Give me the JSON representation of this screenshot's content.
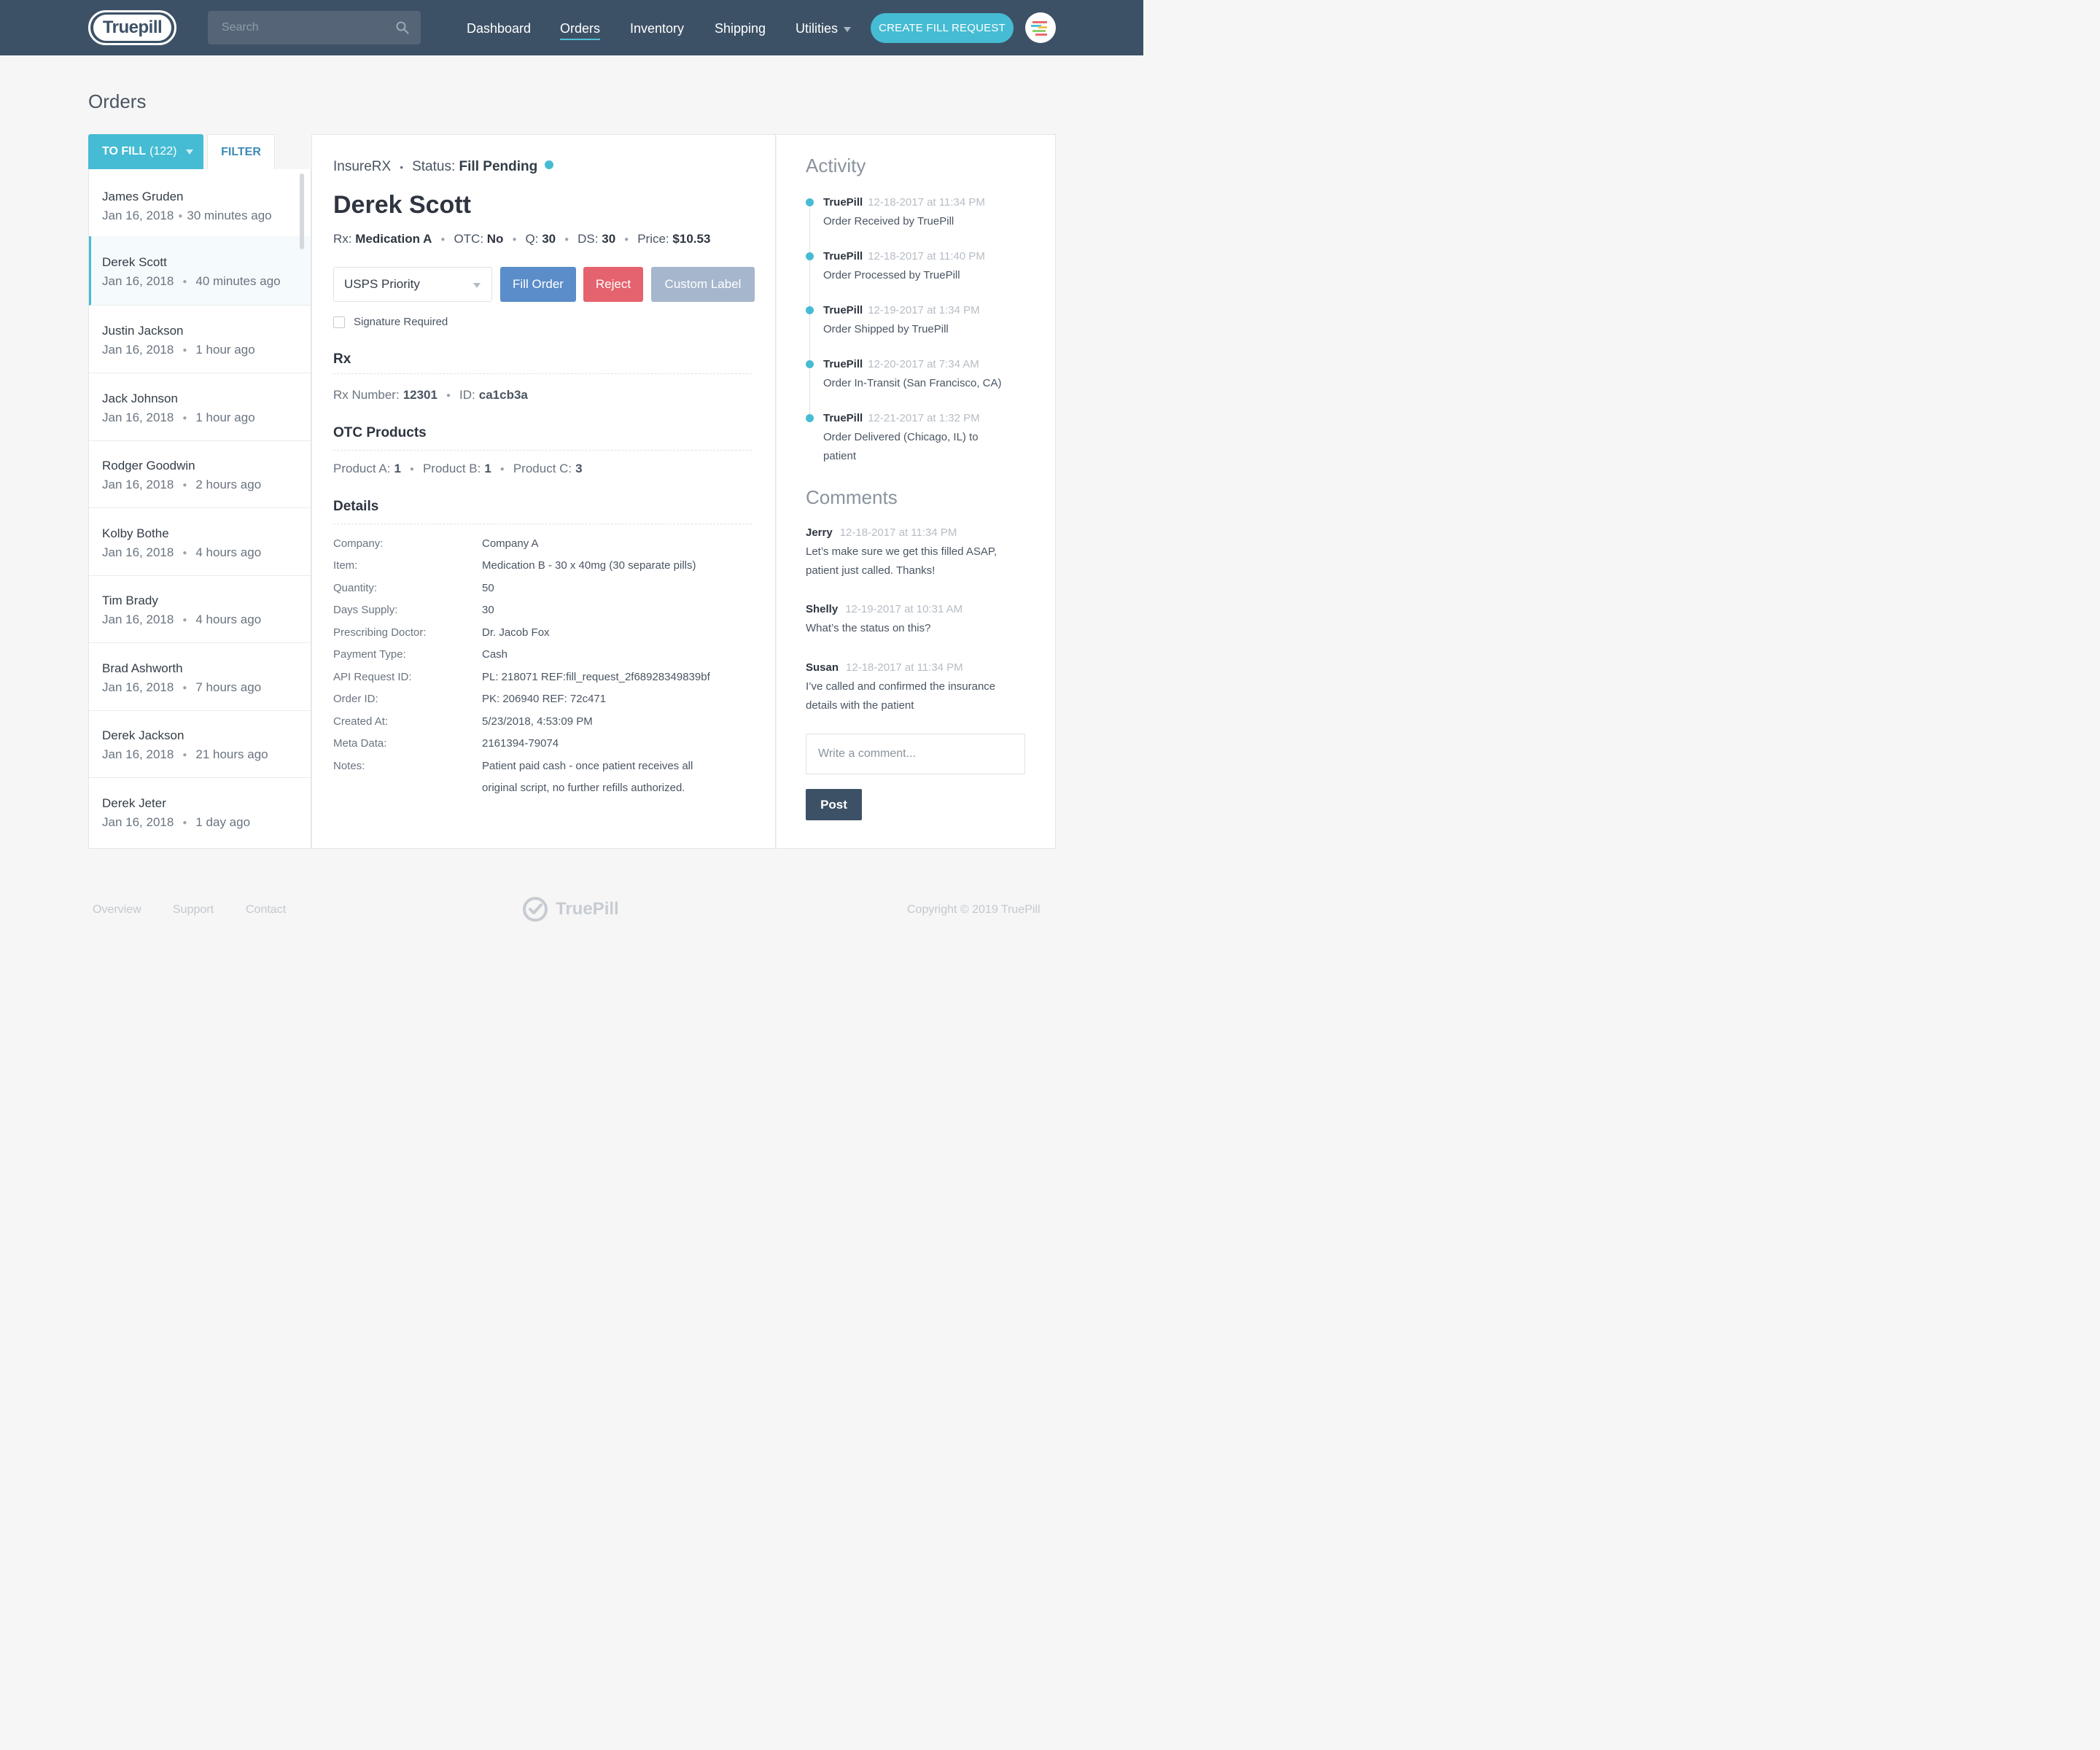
{
  "nav": {
    "logo_text": "Truepill",
    "search_placeholder": "Search",
    "links": [
      "Dashboard",
      "Orders",
      "Inventory",
      "Shipping",
      "Utilities"
    ],
    "create_button": "CREATE FILL REQUEST"
  },
  "page_title": "Orders",
  "tabs": {
    "to_fill": "TO FILL",
    "to_fill_count": "(122)",
    "filter": "FILTER"
  },
  "orders": [
    {
      "name": "James Gruden",
      "date": "Jan 16, 2018",
      "ago": "30 minutes ago"
    },
    {
      "name": "Derek Scott",
      "date": "Jan 16, 2018",
      "ago": "40 minutes ago"
    },
    {
      "name": "Justin Jackson",
      "date": "Jan 16, 2018",
      "ago": "1 hour ago"
    },
    {
      "name": "Jack Johnson",
      "date": "Jan 16, 2018",
      "ago": "1 hour ago"
    },
    {
      "name": "Rodger Goodwin",
      "date": "Jan 16, 2018",
      "ago": "2 hours ago"
    },
    {
      "name": "Kolby Bothe",
      "date": "Jan 16, 2018",
      "ago": "4 hours ago"
    },
    {
      "name": "Tim Brady",
      "date": "Jan 16, 2018",
      "ago": "4 hours ago"
    },
    {
      "name": "Brad Ashworth",
      "date": "Jan 16, 2018",
      "ago": "7 hours ago"
    },
    {
      "name": "Derek Jackson",
      "date": "Jan 16, 2018",
      "ago": "21 hours ago"
    },
    {
      "name": "Derek Jeter",
      "date": "Jan 16, 2018",
      "ago": "1 day ago"
    }
  ],
  "order": {
    "insurer": "InsureRX",
    "status_label": "Status:",
    "status_value": "Fill Pending",
    "patient": "Derek Scott",
    "rx_label": "Rx:",
    "rx_value": "Medication A",
    "otc_label": "OTC:",
    "otc_value": "No",
    "q_label": "Q:",
    "q_value": "30",
    "ds_label": "DS:",
    "ds_value": "30",
    "price_label": "Price:",
    "price_value": "$10.53",
    "shipping_option": "USPS Priority",
    "fill_button": "Fill Order",
    "reject_button": "Reject",
    "custom_label_button": "Custom Label",
    "signature_label": "Signature Required"
  },
  "rx_section": {
    "title": "Rx",
    "number_label": "Rx Number:",
    "number_value": "12301",
    "id_label": "ID:",
    "id_value": "ca1cb3a"
  },
  "otc_section": {
    "title": "OTC Products",
    "products": [
      {
        "label": "Product A:",
        "value": "1"
      },
      {
        "label": "Product B:",
        "value": "1"
      },
      {
        "label": "Product C:",
        "value": "3"
      }
    ]
  },
  "details": {
    "title": "Details",
    "rows": [
      {
        "label": "Company:",
        "value": "Company A"
      },
      {
        "label": "Item:",
        "value": "Medication B - 30 x 40mg (30 separate pills)"
      },
      {
        "label": "Quantity:",
        "value": "50"
      },
      {
        "label": "Days Supply:",
        "value": "30"
      },
      {
        "label": "Prescribing Doctor:",
        "value": "Dr. Jacob Fox"
      },
      {
        "label": "Payment Type:",
        "value": "Cash"
      },
      {
        "label": "API Request ID:",
        "value": "PL: 218071 REF:fill_request_2f68928349839bf"
      },
      {
        "label": "Order ID:",
        "value": "PK: 206940 REF: 72c471"
      },
      {
        "label": "Created At:",
        "value": "5/23/2018, 4:53:09 PM"
      },
      {
        "label": "Meta Data:",
        "value": "2161394-79074"
      },
      {
        "label": "Notes:",
        "value": "Patient paid cash - once patient receives all",
        "value2": "original script, no further refills authorized."
      }
    ]
  },
  "activity": {
    "title": "Activity",
    "events": [
      {
        "actor": "TruePill",
        "time": "12-18-2017 at 11:34 PM",
        "text": "Order Received by TruePill"
      },
      {
        "actor": "TruePill",
        "time": "12-18-2017 at 11:40 PM",
        "text": "Order Processed by TruePill"
      },
      {
        "actor": "TruePill",
        "time": "12-19-2017 at 1:34 PM",
        "text": "Order Shipped by TruePill"
      },
      {
        "actor": "TruePill",
        "time": "12-20-2017 at 7:34 AM",
        "text": "Order In-Transit (San Francisco, CA)"
      },
      {
        "actor": "TruePill",
        "time": "12-21-2017 at 1:32 PM",
        "text": "Order Delivered (Chicago, IL) to patient"
      }
    ]
  },
  "comments": {
    "title": "Comments",
    "items": [
      {
        "author": "Jerry",
        "time": "12-18-2017 at 11:34 PM",
        "text": "Let’s make sure we get this filled ASAP, patient just called. Thanks!"
      },
      {
        "author": "Shelly",
        "time": "12-19-2017 at 10:31 AM",
        "text": "What’s the status on this?"
      },
      {
        "author": "Susan",
        "time": "12-18-2017 at 11:34 PM",
        "text": "I’ve called and confirmed the insurance details with the patient"
      }
    ],
    "input_placeholder": "Write a comment...",
    "post_button": "Post"
  },
  "footer": {
    "links": [
      "Overview",
      "Support",
      "Contact"
    ],
    "logo_text": "TruePill",
    "copyright": "Copyright © 2019 TruePill"
  },
  "colors": {
    "nav_bg": "#3d5166",
    "accent": "#45bcd3",
    "fill_button": "#5a8dc9",
    "reject_button": "#e4636e",
    "custom_label_button": "#a6b6cc"
  }
}
